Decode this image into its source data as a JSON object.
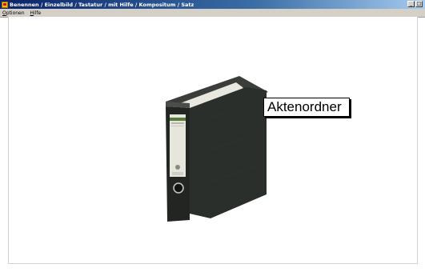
{
  "window": {
    "title": "Benennen / Einzelbild / Tastatur / mit Hilfe / Kompositum / Satz",
    "app_icon": "folder-app-icon",
    "buttons": [
      "minimize",
      "maximize"
    ]
  },
  "menubar": {
    "items": [
      {
        "label": "ptionen",
        "accel": "O"
      },
      {
        "label": "ilfe",
        "accel": "H"
      }
    ]
  },
  "main": {
    "image": "binder-image",
    "word": "Aktenordner"
  },
  "colors": {
    "titlebar_start": "#0a246a",
    "titlebar_end": "#a6caf0",
    "binder": "#2b2f2b"
  }
}
